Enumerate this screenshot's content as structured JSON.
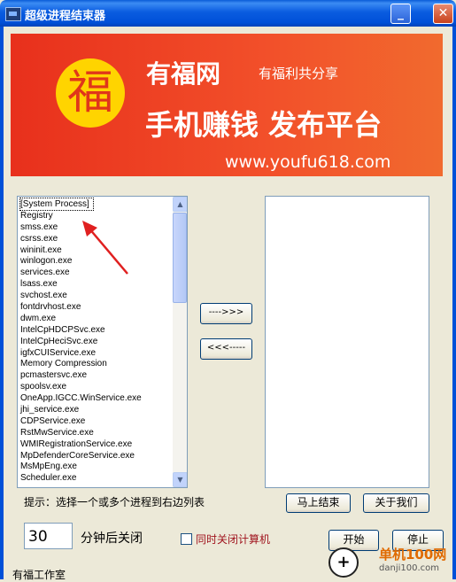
{
  "window": {
    "title": "超级进程结束器",
    "minimize_glyph": "_",
    "close_glyph": "✕"
  },
  "banner": {
    "logo_char": "福",
    "name": "有福网",
    "slogan": "有福利共分享",
    "main": "手机赚钱 发布平台",
    "url": "www.youfu618.com"
  },
  "process_list": [
    "[System Process]",
    "Registry",
    "smss.exe",
    "csrss.exe",
    "wininit.exe",
    "winlogon.exe",
    "services.exe",
    "lsass.exe",
    "svchost.exe",
    "fontdrvhost.exe",
    "dwm.exe",
    "IntelCpHDCPSvc.exe",
    "IntelCpHeciSvc.exe",
    "igfxCUIService.exe",
    "Memory Compression",
    "pcmastersvc.exe",
    "spoolsv.exe",
    "OneApp.IGCC.WinService.exe",
    "jhi_service.exe",
    "CDPService.exe",
    "RstMwService.exe",
    "WMIRegistrationService.exe",
    "MpDefenderCoreService.exe",
    "MsMpEng.exe",
    "Scheduler.exe"
  ],
  "buttons": {
    "move_right": "---->>>",
    "move_left": "<<<-----",
    "end_now": "马上结束",
    "about": "关于我们",
    "start": "开始",
    "stop": "停止"
  },
  "hint": "提示：选择一个或多个进程到右边列表",
  "timer": {
    "minutes_value": "30",
    "label": "分钟后关闭"
  },
  "shutdown_checkbox": {
    "label": "同时关闭计算机",
    "checked": false
  },
  "footer": "有福工作室",
  "watermark": {
    "name": "单机100网",
    "url": "danji100.com"
  },
  "colors": {
    "banner_red": "#e8301c",
    "logo_yellow": "#ffd400",
    "checkbox_label": "#a0141e",
    "arrow": "#e02020"
  }
}
